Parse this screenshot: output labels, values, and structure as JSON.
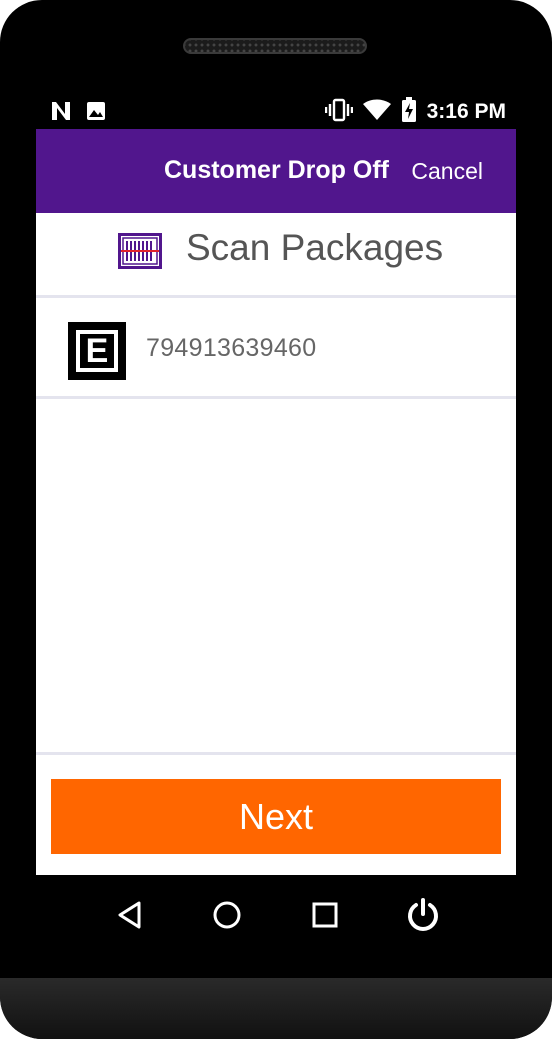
{
  "status_bar": {
    "time": "3:16 PM",
    "left_icons": [
      "n-notification-icon",
      "image-notification-icon"
    ],
    "right_icons": [
      "vibrate-icon",
      "wifi-icon",
      "battery-charging-icon"
    ]
  },
  "app_bar": {
    "title": "Customer Drop Off",
    "cancel_label": "Cancel",
    "color": "#51168d"
  },
  "section": {
    "title": "Scan Packages",
    "icon": "barcode-scan-icon"
  },
  "packages": [
    {
      "badge": "E",
      "number": "794913639460"
    }
  ],
  "footer": {
    "next_label": "Next",
    "button_color": "#ff6600"
  },
  "nav_bar": {
    "buttons": [
      "back-icon",
      "home-icon",
      "recents-icon",
      "power-icon"
    ]
  }
}
